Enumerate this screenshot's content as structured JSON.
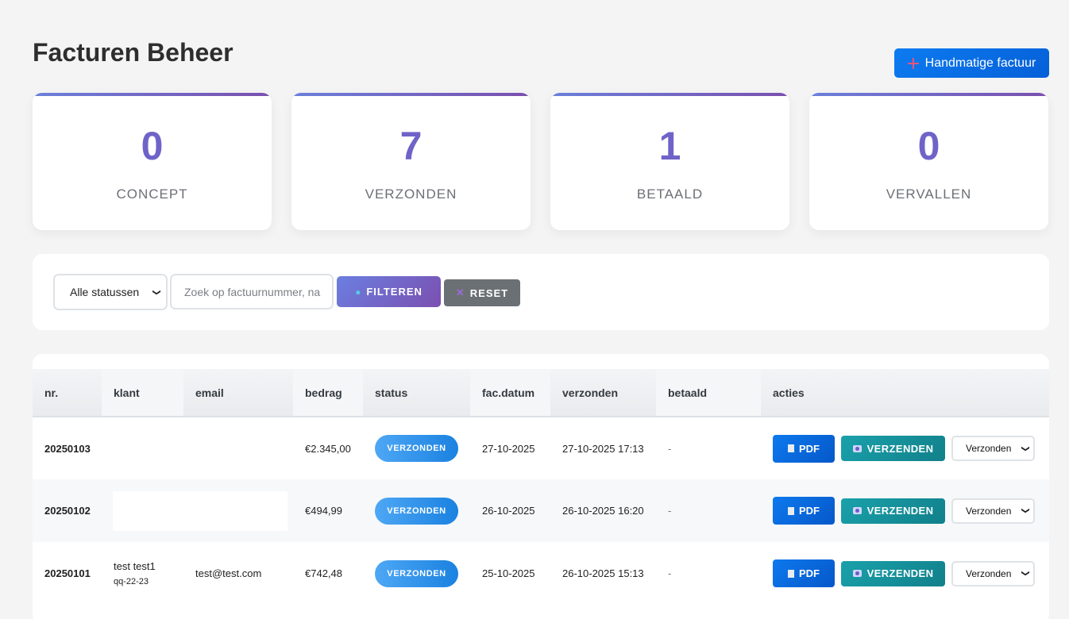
{
  "header": {
    "title": "Facturen Beheer",
    "add_button_label": "Handmatige factuur"
  },
  "stats": [
    {
      "value": "0",
      "label": "CONCEPT"
    },
    {
      "value": "7",
      "label": "VERZONDEN"
    },
    {
      "value": "1",
      "label": "BETAALD"
    },
    {
      "value": "0",
      "label": "VERVALLEN"
    }
  ],
  "filters": {
    "status_selected": "Alle statussen",
    "search_placeholder": "Zoek op factuurnummer, na",
    "filter_label": "FILTEREN",
    "reset_label": "RESET"
  },
  "table": {
    "columns": [
      "nr.",
      "klant",
      "email",
      "bedrag",
      "status",
      "fac.datum",
      "verzonden",
      "betaald",
      "acties"
    ],
    "rows": [
      {
        "nr": "20250103",
        "klant": "",
        "klant_sub": "",
        "email": "",
        "bedrag": "€2.345,00",
        "status": "VERZONDEN",
        "fac_datum": "27-10-2025",
        "verzonden": "27-10-2025 17:13",
        "betaald": "-",
        "pdf": "PDF",
        "send": "VERZENDEN",
        "select": "Verzonden"
      },
      {
        "nr": "20250102",
        "klant": "",
        "klant_sub": "",
        "email": "",
        "bedrag": "€494,99",
        "status": "VERZONDEN",
        "fac_datum": "26-10-2025",
        "verzonden": "26-10-2025 16:20",
        "betaald": "-",
        "pdf": "PDF",
        "send": "VERZENDEN",
        "select": "Verzonden"
      },
      {
        "nr": "20250101",
        "klant": "test test1",
        "klant_sub": "qq-22-23",
        "email": "test@test.com",
        "bedrag": "€742,48",
        "status": "VERZONDEN",
        "fac_datum": "25-10-2025",
        "verzonden": "26-10-2025 15:13",
        "betaald": "-",
        "pdf": "PDF",
        "send": "VERZENDEN",
        "select": "Verzonden"
      }
    ]
  },
  "colors": {
    "accent": "#6f63c8",
    "primary_blue": "#0d7bf0",
    "teal": "#1aa1ab"
  }
}
